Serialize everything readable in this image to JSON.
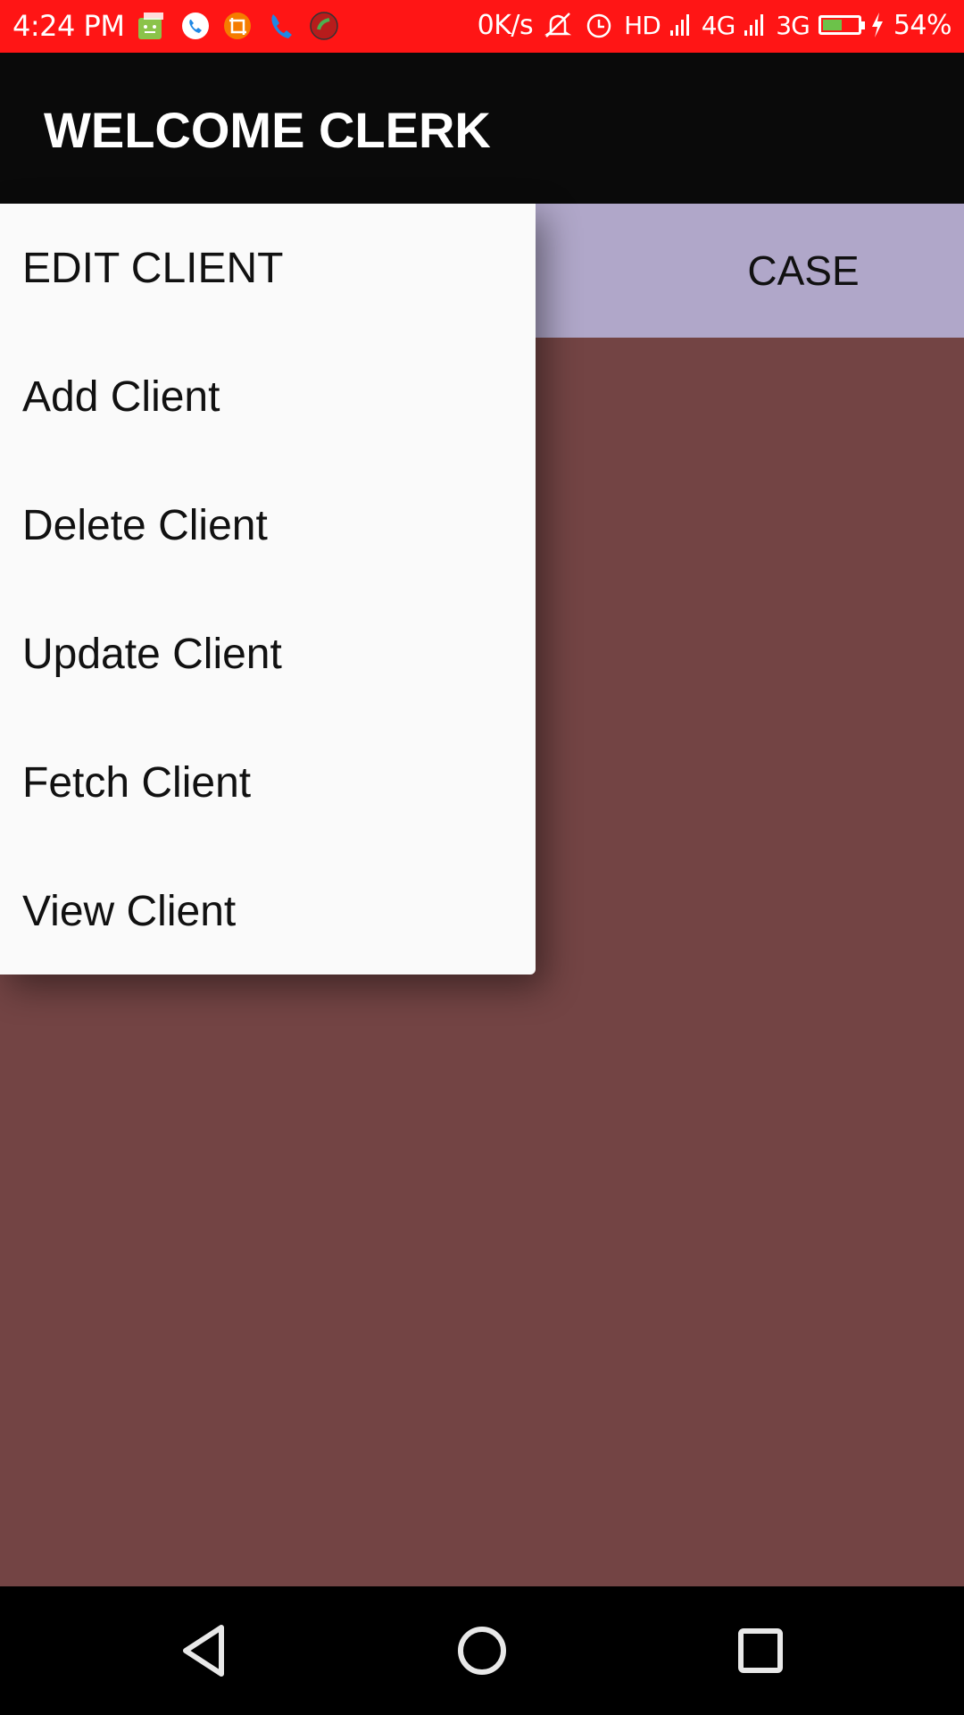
{
  "status_bar": {
    "time": "4:24 PM",
    "network_speed": "0K/s",
    "hd_label": "HD",
    "net_4g": "4G",
    "net_3g": "3G",
    "battery_level": 0.54,
    "battery_percent": "54%",
    "notification_icons": [
      "android-app-icon",
      "phone-call-icon",
      "screenshot-icon",
      "phone-icon",
      "call-recorder-icon"
    ],
    "colors": {
      "background": "#ff1515",
      "text": "#ffffff"
    }
  },
  "app_bar": {
    "title": "WELCOME CLERK",
    "background": "#0a0a0a"
  },
  "tabs": {
    "items": [
      {
        "label": "CASE"
      }
    ],
    "background": "#b0a7c9"
  },
  "menu": {
    "items": [
      {
        "label": "EDIT CLIENT"
      },
      {
        "label": "Add Client"
      },
      {
        "label": "Delete Client"
      },
      {
        "label": "Update Client"
      },
      {
        "label": "Fetch Client"
      },
      {
        "label": "View Client"
      }
    ],
    "background": "#fafafa"
  },
  "content": {
    "background": "#734444"
  },
  "nav_bar": {
    "buttons": [
      "back-icon",
      "home-icon",
      "recents-icon"
    ]
  }
}
